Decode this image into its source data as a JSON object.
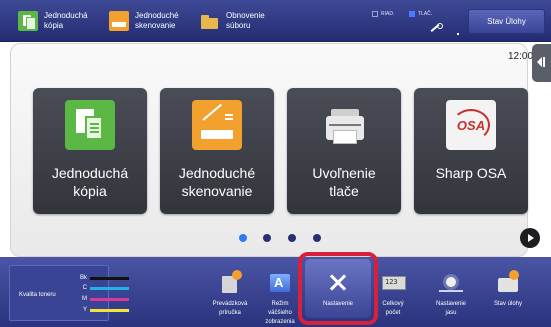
{
  "topbar": {
    "shortcuts": [
      {
        "label": "Jednoduchá\nkópia"
      },
      {
        "label": "Jednoduché\nskenovanie"
      },
      {
        "label": "Obnovenie\nsúboru"
      }
    ],
    "indicator_data": "RIAD.",
    "indicator_print": "TLAČ.",
    "status_button": "Stav Úlohy"
  },
  "home": {
    "clock": "12:00",
    "tiles": [
      {
        "label": "Jednoduchá\nkópia"
      },
      {
        "label": "Jednoduché\nskenovanie"
      },
      {
        "label": "Uvoľnenie\ntlače"
      },
      {
        "label": "Sharp OSA"
      }
    ],
    "osa_mark": "OSA",
    "page_count": 4,
    "active_page": 1
  },
  "bottombar": {
    "toner": {
      "title": "Kvalita toneru",
      "rows": [
        {
          "label": "Bk",
          "color": "#111111"
        },
        {
          "label": "C",
          "color": "#22b3e6"
        },
        {
          "label": "M",
          "color": "#d83a9c"
        },
        {
          "label": "Y",
          "color": "#f2e23a"
        }
      ]
    },
    "functions": [
      {
        "label": "Prevádzková\npríručka"
      },
      {
        "label": "Režim\nväčšieho\nzobrazenia"
      },
      {
        "label": "Nastavenie"
      },
      {
        "label": "Celkový\npočet"
      },
      {
        "label": "Nastavenie\njasu"
      },
      {
        "label": "Stav úlohy"
      }
    ]
  },
  "colors": {
    "topbar": "#2b3480",
    "accent_highlight": "#d8203a",
    "pager_active": "#2f7cf0"
  }
}
